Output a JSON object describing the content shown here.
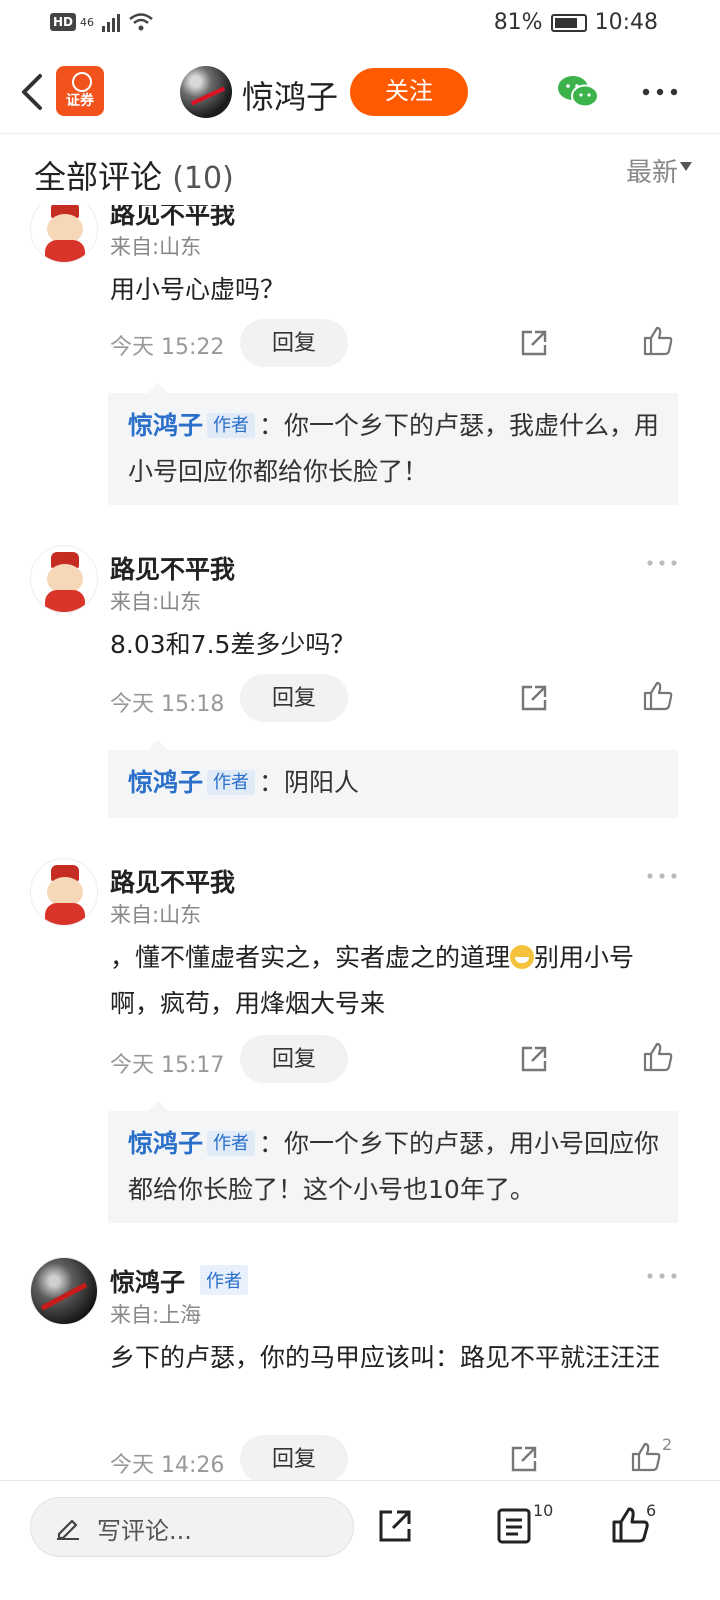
{
  "status_bar": {
    "left_badge": "HD",
    "network": "46",
    "battery": "81%",
    "time": "10:48"
  },
  "header": {
    "app_logo_text": "证券",
    "author_name": "惊鸿子",
    "follow_label": "关注"
  },
  "comments_header": {
    "title": "全部评论",
    "count": "(10)",
    "sort_label": "最新"
  },
  "comments": [
    {
      "user": "路见不平我",
      "location": "来自:山东",
      "text": "用小号心虚吗？",
      "time": "今天 15:22",
      "reply_label": "回复",
      "reply": {
        "author": "惊鸿子",
        "badge": "作者",
        "text": "：你一个乡下的卢瑟，我虚什么，用小号回应你都给你长脸了！"
      }
    },
    {
      "user": "路见不平我",
      "location": "来自:山东",
      "text": "8.03和7.5差多少吗？",
      "time": "今天 15:18",
      "reply_label": "回复",
      "reply": {
        "author": "惊鸿子",
        "badge": "作者",
        "text": "：阴阳人"
      }
    },
    {
      "user": "路见不平我",
      "location": "来自:山东",
      "text_before_emoji": "，懂不懂虚者实之，实者虚之的道理",
      "text_after_emoji": "别用小号啊，疯苟，用烽烟大号来",
      "time": "今天 15:17",
      "reply_label": "回复",
      "reply": {
        "author": "惊鸿子",
        "badge": "作者",
        "text": "：你一个乡下的卢瑟，用小号回应你都给你长脸了！这个小号也10年了。"
      }
    },
    {
      "user": "惊鸿子",
      "badge": "作者",
      "location": "来自:上海",
      "text": "乡下的卢瑟，你的马甲应该叫：路见不平就汪汪汪",
      "time": "今天 14:26",
      "reply_label": "回复",
      "like_count": "2"
    }
  ],
  "bottom_bar": {
    "placeholder": "写评论...",
    "comment_count": "10",
    "like_count": "6"
  },
  "icons": [
    "back-icon",
    "wechat-icon",
    "more-icon",
    "share-icon",
    "like-icon",
    "pen-icon",
    "comment-list-icon"
  ],
  "colors": {
    "accent": "#ff5a00",
    "author_blue": "#2a6fc9"
  }
}
